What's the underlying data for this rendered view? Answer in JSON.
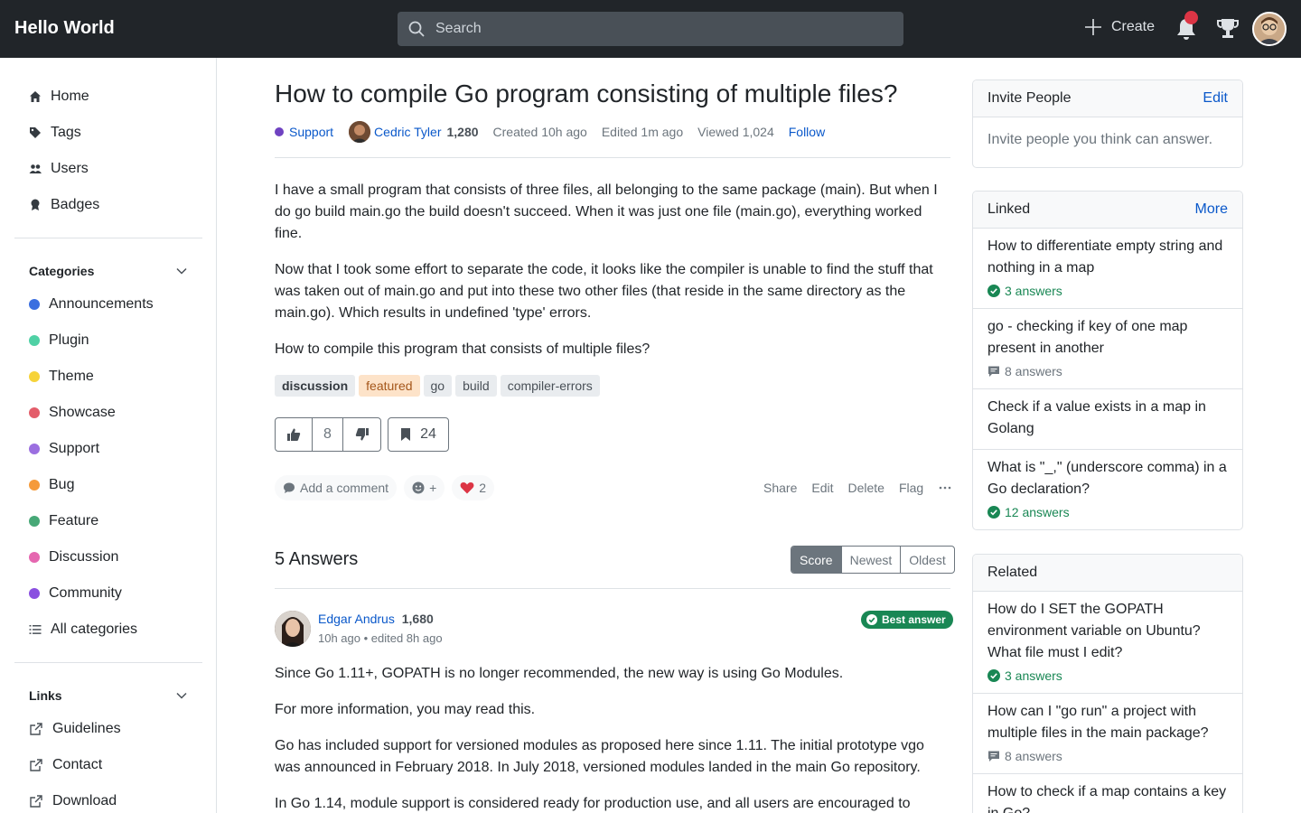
{
  "header": {
    "brand": "Hello World",
    "search_placeholder": "Search",
    "create_label": "Create"
  },
  "sidebar": {
    "nav": [
      {
        "label": "Home",
        "icon": "home-icon"
      },
      {
        "label": "Tags",
        "icon": "tags-icon"
      },
      {
        "label": "Users",
        "icon": "users-icon"
      },
      {
        "label": "Badges",
        "icon": "badge-icon"
      }
    ],
    "categories_title": "Categories",
    "categories": [
      {
        "label": "Announcements",
        "color": "#3b6fe0"
      },
      {
        "label": "Plugin",
        "color": "#4fd1a5"
      },
      {
        "label": "Theme",
        "color": "#f6d33a"
      },
      {
        "label": "Showcase",
        "color": "#e35d6a"
      },
      {
        "label": "Support",
        "color": "#9b6fe0"
      },
      {
        "label": "Bug",
        "color": "#f59a3b"
      },
      {
        "label": "Feature",
        "color": "#47a877"
      },
      {
        "label": "Discussion",
        "color": "#e567b0"
      },
      {
        "label": "Community",
        "color": "#8a4fe0"
      },
      {
        "label": "All categories",
        "color": ""
      }
    ],
    "links_title": "Links",
    "links": [
      {
        "label": "Guidelines"
      },
      {
        "label": "Contact"
      },
      {
        "label": "Download"
      }
    ]
  },
  "question": {
    "title": "How to compile Go program consisting of multiple files?",
    "category": "Support",
    "author": "Cedric Tyler",
    "author_rep": "1,280",
    "created": "Created 10h ago",
    "edited": "Edited 1m ago",
    "viewed": "Viewed 1,024",
    "follow": "Follow",
    "paragraphs": [
      "I have a small program that consists of three files, all belonging to the same package (main). But when I do go build main.go the build doesn't succeed. When it was just one file (main.go), everything worked fine.",
      "Now that I took some effort to separate the code, it looks like the compiler is unable to find the stuff that was taken out of main.go and put into these two other files (that reside in the same directory as the main.go). Which results in undefined 'type' errors.",
      "How to compile this program that consists of multiple files?"
    ],
    "tags": [
      "discussion",
      "featured",
      "go",
      "build",
      "compiler-errors"
    ],
    "votes": "8",
    "bookmarks": "24",
    "add_comment": "Add a comment",
    "reaction_add": "+",
    "hearts": "2",
    "links": [
      "Share",
      "Edit",
      "Delete",
      "Flag"
    ]
  },
  "answers": {
    "title": "5 Answers",
    "sort": [
      "Score",
      "Newest",
      "Oldest"
    ],
    "first": {
      "author": "Edgar Andrus",
      "author_rep": "1,680",
      "time": "10h ago • edited 8h ago",
      "best": "Best answer",
      "paragraphs": [
        "Since Go 1.11+, GOPATH is no longer recommended, the new way is using Go Modules.",
        "For more information, you may read this.",
        "Go has included support for versioned modules as proposed here since 1.11. The initial prototype vgo was announced in February 2018. In July 2018, versioned modules landed in the main Go repository.",
        "In Go 1.14, module support is considered ready for production use, and all users are encouraged to"
      ]
    }
  },
  "right": {
    "invite": {
      "title": "Invite People",
      "edit": "Edit",
      "body": "Invite people you think can answer."
    },
    "linked": {
      "title": "Linked",
      "more": "More",
      "items": [
        {
          "title": "How to differentiate empty string and nothing in a map",
          "count": "3 answers",
          "accepted": true
        },
        {
          "title": "go - checking if key of one map present in another",
          "count": "8 answers",
          "accepted": false
        },
        {
          "title": "Check if a value exists in a map in Golang",
          "count": "",
          "accepted": false
        },
        {
          "title": "What is \"_,\" (underscore comma) in a Go declaration?",
          "count": "12 answers",
          "accepted": true
        }
      ]
    },
    "related": {
      "title": "Related",
      "items": [
        {
          "title": "How do I SET the GOPATH environment variable on Ubuntu? What file must I edit?",
          "count": "3 answers",
          "accepted": true
        },
        {
          "title": "How can I \"go run\" a project with multiple files in the main package?",
          "count": "8 answers",
          "accepted": false
        },
        {
          "title": "How to check if a map contains a key in Go?",
          "count": "",
          "accepted": false
        }
      ]
    }
  }
}
